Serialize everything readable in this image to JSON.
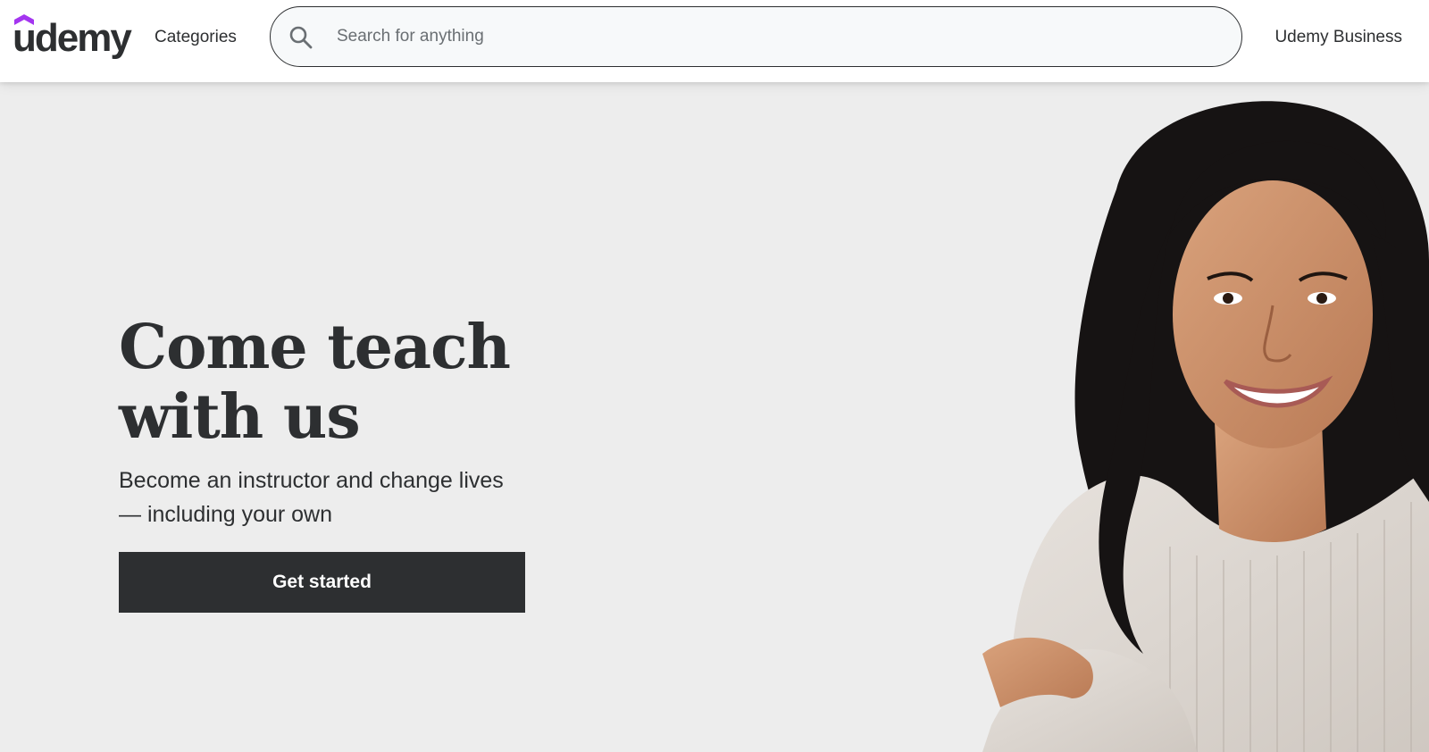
{
  "header": {
    "logo_text": "udemy",
    "categories_label": "Categories",
    "search": {
      "placeholder": "Search for anything",
      "value": ""
    },
    "business_link": "Udemy Business"
  },
  "hero": {
    "title": "Come teach with us",
    "subtitle": "Become an instructor and change lives — including your own",
    "cta_label": "Get started"
  },
  "colors": {
    "brand_purple": "#a435f0",
    "dark": "#2d2f31",
    "hero_bg": "#ededed"
  },
  "icons": {
    "search": "search-icon",
    "logo_cap": "graduation-cap-icon"
  }
}
